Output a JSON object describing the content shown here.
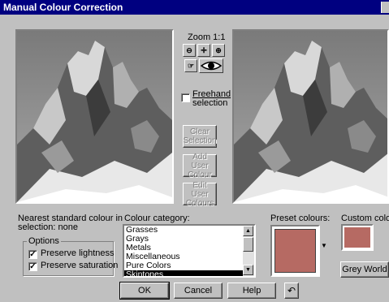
{
  "window": {
    "title": "Manual Colour Correction"
  },
  "zoom": {
    "label": "Zoom 1:1"
  },
  "freehand": {
    "label_line1": "Freehand",
    "label_line2": "selection",
    "checked": false
  },
  "buttons": {
    "clear_selection": [
      "Clear",
      "Selection"
    ],
    "add_user_colour": [
      "Add User",
      "Colour"
    ],
    "edit_user_colours": [
      "Edit User",
      "Colours"
    ],
    "ok": "OK",
    "cancel": "Cancel",
    "help": "Help",
    "grey_world": "Grey World"
  },
  "nearest": {
    "line1": "Nearest standard colour in",
    "line2": "selection: none"
  },
  "options": {
    "title": "Options",
    "preserve_lightness": "Preserve lightness",
    "preserve_saturation": "Preserve saturation"
  },
  "category": {
    "label": "Colour category:",
    "items": [
      "Grasses",
      "Grays",
      "Metals",
      "Miscellaneous",
      "Pure Colors",
      "Skintones"
    ],
    "selected": "Skintones"
  },
  "preset": {
    "label": "Preset colours:",
    "color": "#b66a63"
  },
  "custom": {
    "label": "Custom colour:",
    "color": "#b66a63"
  }
}
